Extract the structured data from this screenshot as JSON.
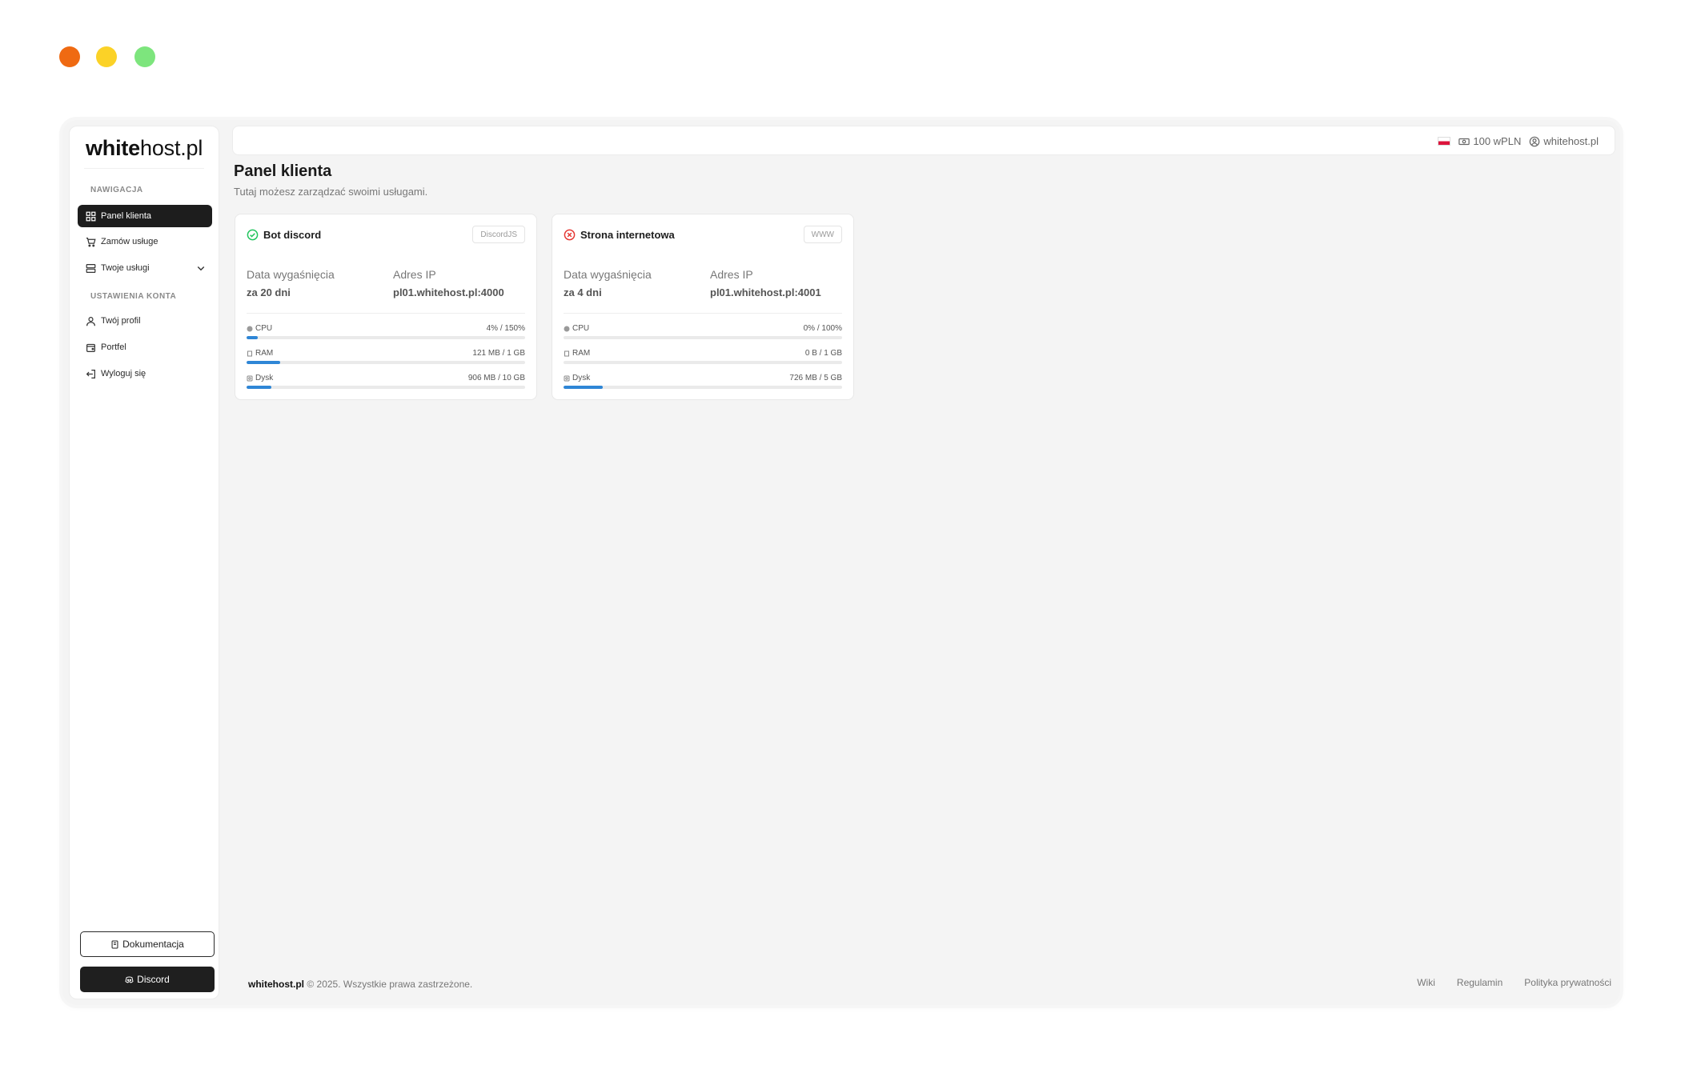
{
  "brand": {
    "bold": "white",
    "rest": "host.pl"
  },
  "sidebar": {
    "section_nav": "NAWIGACJA",
    "section_account": "USTAWIENIA KONTA",
    "items": [
      {
        "label": "Panel klienta",
        "icon": "dashboard-icon",
        "active": true
      },
      {
        "label": "Zamów usługe",
        "icon": "cart-icon"
      },
      {
        "label": "Twoje usługi",
        "icon": "server-icon",
        "has_dropdown": true
      },
      {
        "label": "Twój profil",
        "icon": "user-icon"
      },
      {
        "label": "Portfel",
        "icon": "wallet-icon"
      },
      {
        "label": "Wyloguj się",
        "icon": "logout-icon"
      }
    ],
    "docs_button": "Dokumentacja",
    "discord_button": "Discord"
  },
  "topbar": {
    "balance": "100 wPLN",
    "username": "whitehost.pl"
  },
  "page": {
    "title": "Panel klienta",
    "subtitle": "Tutaj możesz zarządzać swoimi usługami."
  },
  "info_labels": {
    "expiry": "Data wygaśnięcia",
    "ip": "Adres IP"
  },
  "cards": [
    {
      "name": "Bot discord",
      "status": "active",
      "tag": "DiscordJS",
      "expiry": "za 20 dni",
      "ip": "pl01.whitehost.pl:4000",
      "metrics": [
        {
          "label": "CPU",
          "value": "4% / 150%",
          "percent": 4
        },
        {
          "label": "RAM",
          "value": "121 MB / 1 GB",
          "percent": 12
        },
        {
          "label": "Dysk",
          "value": "906 MB / 10 GB",
          "percent": 9
        }
      ]
    },
    {
      "name": "Strona internetowa",
      "status": "stopped",
      "tag": "WWW",
      "expiry": "za 4 dni",
      "ip": "pl01.whitehost.pl:4001",
      "metrics": [
        {
          "label": "CPU",
          "value": "0% / 100%",
          "percent": 0
        },
        {
          "label": "RAM",
          "value": "0 B / 1 GB",
          "percent": 0
        },
        {
          "label": "Dysk",
          "value": "726 MB / 5 GB",
          "percent": 14
        }
      ]
    }
  ],
  "footer": {
    "brand": "whitehost.pl",
    "copyright": "© 2025. Wszystkie prawa zastrzeżone.",
    "links": [
      "Wiki",
      "Regulamin",
      "Polityka prywatności"
    ]
  },
  "colors": {
    "active": "#22c55e",
    "stopped": "#e53935",
    "bar": "#2e86d6"
  }
}
